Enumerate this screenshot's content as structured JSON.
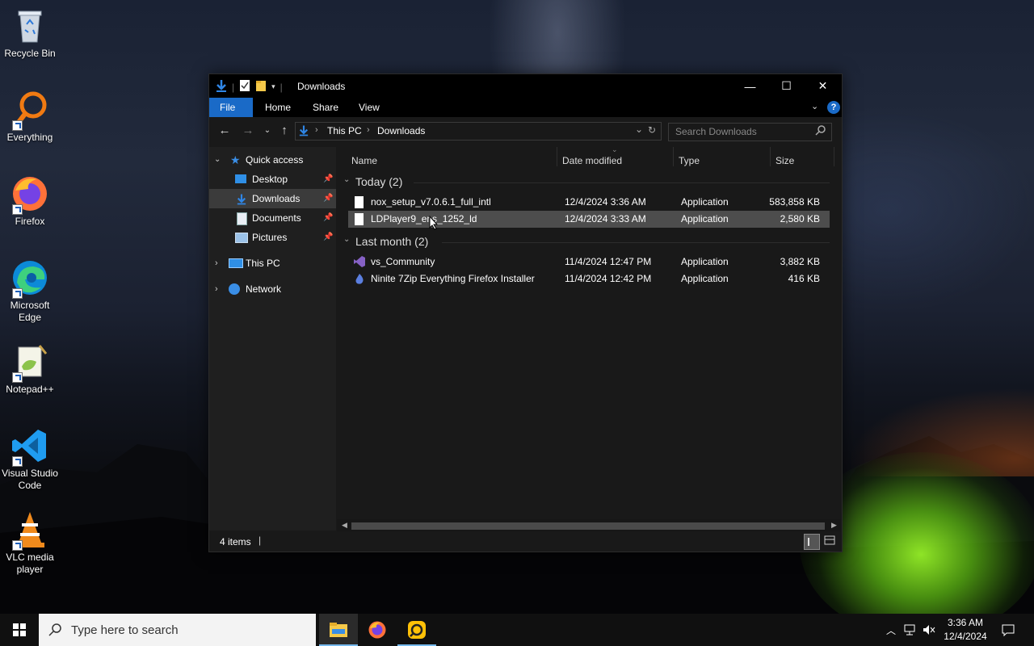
{
  "desktop": {
    "icons": [
      {
        "label": "Recycle Bin",
        "icon": "recycle-bin-icon"
      },
      {
        "label": "Everything",
        "icon": "everything-search-icon"
      },
      {
        "label": "Firefox",
        "icon": "firefox-icon"
      },
      {
        "label": "Microsoft Edge",
        "icon": "edge-icon"
      },
      {
        "label": "Notepad++",
        "icon": "notepad-plus-plus-icon"
      },
      {
        "label": "Visual Studio Code",
        "icon": "vscode-icon"
      },
      {
        "label": "VLC media player",
        "icon": "vlc-icon"
      }
    ]
  },
  "explorer": {
    "title": "Downloads",
    "controls": {
      "minimize": "—",
      "maximize": "☐",
      "close": "✕"
    },
    "ribbon_tabs": [
      "File",
      "Home",
      "Share",
      "View"
    ],
    "breadcrumb": [
      "This PC",
      "Downloads"
    ],
    "search_placeholder": "Search Downloads",
    "nav": {
      "quick_access": "Quick access",
      "items": [
        {
          "label": "Desktop",
          "pinned": true
        },
        {
          "label": "Downloads",
          "pinned": true,
          "selected": true
        },
        {
          "label": "Documents",
          "pinned": true
        },
        {
          "label": "Pictures",
          "pinned": true
        }
      ],
      "this_pc": "This PC",
      "network": "Network"
    },
    "columns": [
      "Name",
      "Date modified",
      "Type",
      "Size"
    ],
    "groups": [
      {
        "label": "Today (2)",
        "files": [
          {
            "name": "nox_setup_v7.0.6.1_full_intl",
            "date": "12/4/2024 3:36 AM",
            "type": "Application",
            "size": "583,858 KB",
            "icon": "blank-file-icon"
          },
          {
            "name": "LDPlayer9_ens_1252_ld",
            "date": "12/4/2024 3:33 AM",
            "type": "Application",
            "size": "2,580 KB",
            "icon": "blank-file-icon",
            "highlighted": true
          }
        ]
      },
      {
        "label": "Last month (2)",
        "files": [
          {
            "name": "vs_Community",
            "date": "11/4/2024 12:47 PM",
            "type": "Application",
            "size": "3,882 KB",
            "icon": "visual-studio-icon"
          },
          {
            "name": "Ninite 7Zip Everything Firefox Installer",
            "date": "11/4/2024 12:42 PM",
            "type": "Application",
            "size": "416 KB",
            "icon": "ninite-icon"
          }
        ]
      }
    ],
    "status": "4 items"
  },
  "taskbar": {
    "search_placeholder": "Type here to search",
    "apps": [
      "file-explorer-icon",
      "firefox-icon",
      "ldplayer-icon"
    ],
    "clock_time": "3:36 AM",
    "clock_date": "12/4/2024"
  },
  "colors": {
    "accent": "#1a6ac7",
    "window_bg": "#191919",
    "taskbar_bg": "#101010",
    "highlight_row": "#4d4d4d"
  }
}
